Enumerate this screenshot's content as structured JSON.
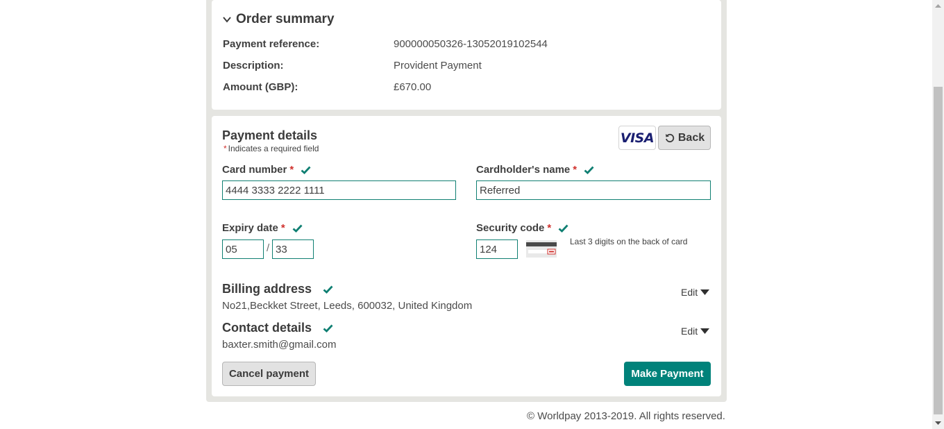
{
  "summary": {
    "title": "Order summary",
    "payment_reference_label": "Payment reference:",
    "payment_reference_value": "900000050326-13052019102544",
    "description_label": "Description:",
    "description_value": "Provident Payment",
    "amount_label": "Amount (GBP):",
    "amount_value": "£670.00"
  },
  "payment": {
    "title": "Payment details",
    "required_star": "*",
    "required_note": "Indicates a required field",
    "card_brand": "VISA",
    "back_label": "Back",
    "card_number_label": "Card number",
    "card_number_value": "4444 3333 2222 1111",
    "cardholder_label": "Cardholder's name",
    "cardholder_value": "Referred",
    "expiry_label": "Expiry date",
    "expiry_month": "05",
    "expiry_separator": "/",
    "expiry_year": "33",
    "security_label": "Security code",
    "security_value": "124",
    "security_hint": "Last 3 digits on the back of card"
  },
  "billing": {
    "title": "Billing address",
    "value": "No21,Beckket Street, Leeds, 600032, United Kingdom",
    "edit_label": "Edit"
  },
  "contact": {
    "title": "Contact details",
    "value": "baxter.smith@gmail.com",
    "edit_label": "Edit"
  },
  "actions": {
    "cancel_label": "Cancel payment",
    "pay_label": "Make Payment"
  },
  "footer": {
    "text": "© Worldpay 2013-2019. All rights reserved."
  },
  "colors": {
    "accent": "#00827a",
    "required": "#d0312d",
    "tick": "#0f7f72",
    "panel_bg": "#e5e5e1"
  }
}
